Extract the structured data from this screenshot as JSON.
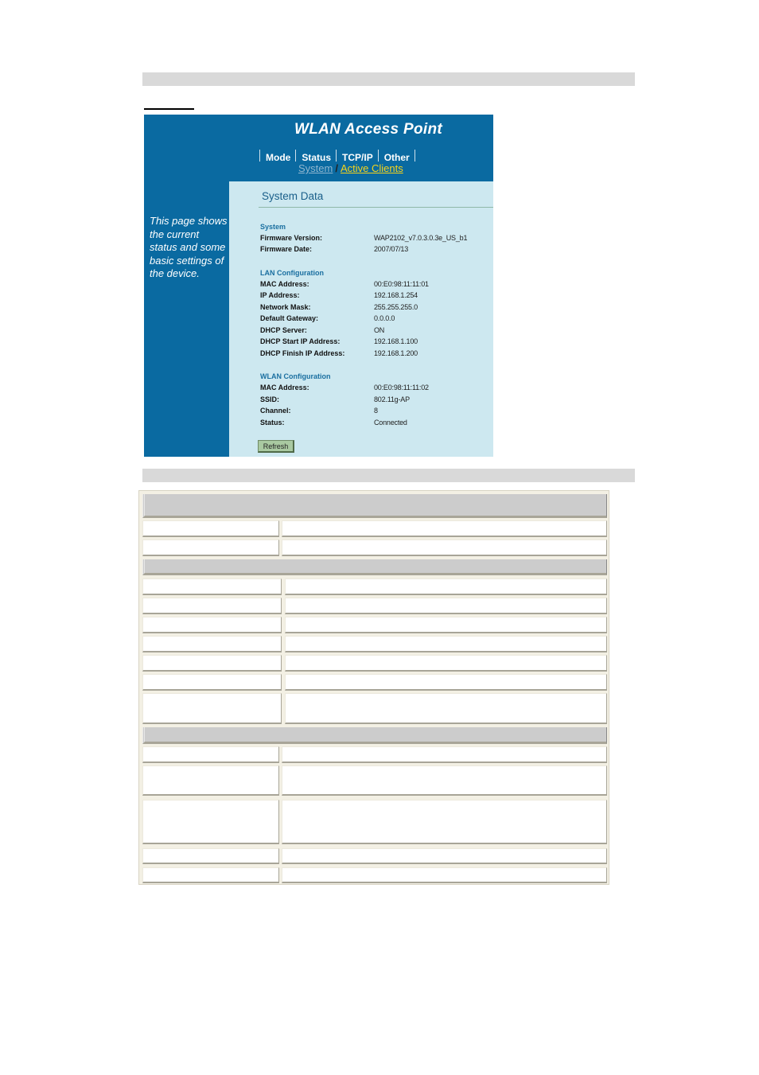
{
  "device": {
    "title": "WLAN Access Point",
    "tabs": [
      "Mode",
      "Status",
      "TCP/IP",
      "Other"
    ],
    "subnav": {
      "system": "System",
      "separator": "/",
      "active_clients": "Active Clients"
    },
    "sidebar_text": "This page shows the current status and some basic settings of the device.",
    "main_title": "System Data",
    "sections": {
      "system": {
        "label": "System",
        "rows": [
          {
            "key": "Firmware Version:",
            "value": "WAP2102_v7.0.3.0.3e_US_b1"
          },
          {
            "key": "Firmware Date:",
            "value": "2007/07/13"
          }
        ]
      },
      "lan": {
        "label": "LAN Configuration",
        "rows": [
          {
            "key": "MAC Address:",
            "value": "00:E0:98:11:11:01"
          },
          {
            "key": "IP Address:",
            "value": "192.168.1.254"
          },
          {
            "key": "Network Mask:",
            "value": "255.255.255.0"
          },
          {
            "key": "Default Gateway:",
            "value": "0.0.0.0"
          },
          {
            "key": "DHCP Server:",
            "value": "ON"
          },
          {
            "key": "DHCP Start IP Address:",
            "value": "192.168.1.100"
          },
          {
            "key": "DHCP Finish IP Address:",
            "value": "192.168.1.200"
          }
        ]
      },
      "wlan": {
        "label": "WLAN Configuration",
        "rows": [
          {
            "key": "MAC Address:",
            "value": "00:E0:98:11:11:02"
          },
          {
            "key": "SSID:",
            "value": "802.11g-AP"
          },
          {
            "key": "Channel:",
            "value": "8"
          },
          {
            "key": "Status:",
            "value": "Connected"
          }
        ]
      }
    },
    "refresh_label": "Refresh"
  },
  "colors": {
    "header_blue": "#0a6aa1",
    "panel_bg": "#cde8f0",
    "active_link": "#f5d31a",
    "section_label": "#1a6fa0",
    "button_green": "#a9c9a1"
  }
}
